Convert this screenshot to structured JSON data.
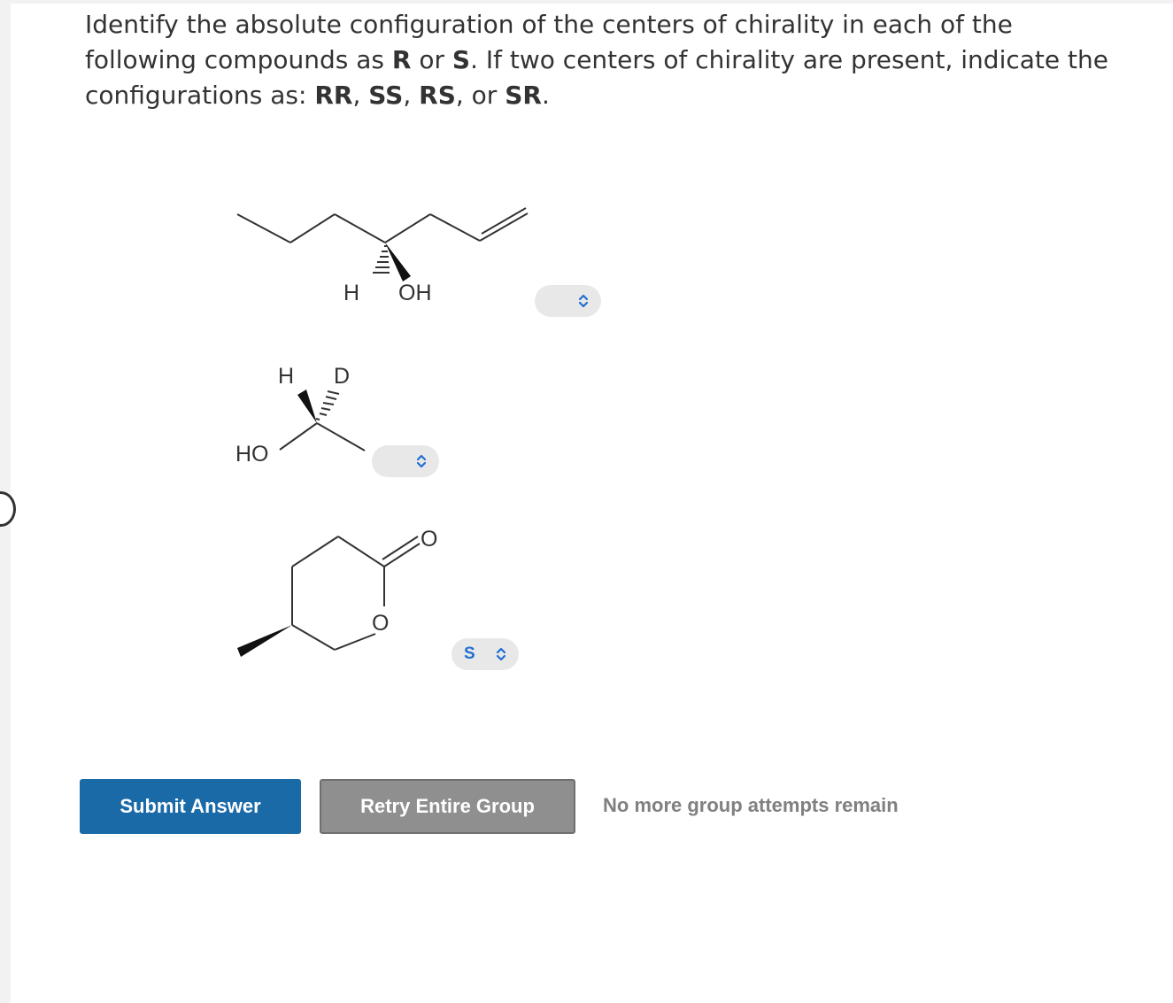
{
  "question": {
    "text_a": "Identify the absolute configuration of the centers of chirality in each of the following compounds as ",
    "bold_r": "R",
    "text_b": " or ",
    "bold_s": "S",
    "text_c": ". If two centers of chirality are present, indicate the configurations as: ",
    "bold_rr": "RR",
    "sep_1": ", ",
    "bold_ss": "SS",
    "sep_2": ", ",
    "bold_rs": "RS",
    "sep_3": ", or ",
    "bold_sr": "SR",
    "text_d": "."
  },
  "compounds": [
    {
      "atom_labels": [
        "H",
        "OH"
      ],
      "answer_value": ""
    },
    {
      "atom_labels": [
        "H",
        "D",
        "HO"
      ],
      "answer_value": ""
    },
    {
      "atom_labels": [
        "O",
        "O"
      ],
      "answer_value": "S"
    }
  ],
  "buttons": {
    "submit_label": "Submit Answer",
    "retry_label": "Retry Entire Group"
  },
  "status": {
    "attempts_text": "No more group attempts remain"
  },
  "colors": {
    "submit_bg": "#1a6aa8",
    "retry_bg": "#8f8f8f",
    "select_bg": "#e8e8e8",
    "select_value": "#1f6fd1"
  }
}
